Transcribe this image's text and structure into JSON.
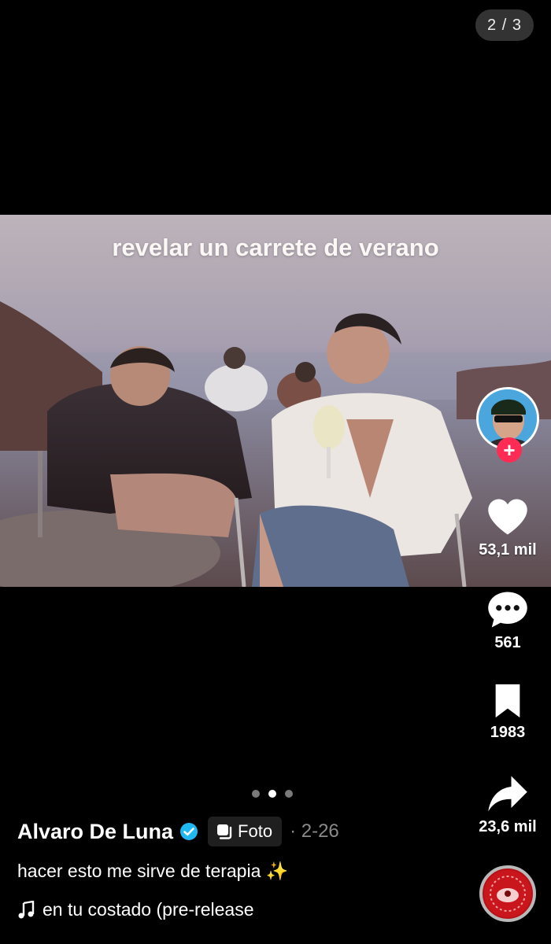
{
  "carousel": {
    "page_counter": "2 / 3",
    "total_pages": 3,
    "active_page": 2
  },
  "photo": {
    "overlay_text": "revelar un carrete de verano"
  },
  "actions": {
    "likes": "53,1 mil",
    "comments": "561",
    "saves": "1983",
    "shares": "23,6 mil"
  },
  "post": {
    "username": "Alvaro De Luna",
    "verified": true,
    "type_label": "Foto",
    "date": "· 2-26",
    "caption": "hacer esto me sirve de terapia",
    "caption_emoji": "✨",
    "music": "en tu costado (pre-release"
  },
  "icons": {
    "like": "heart-icon",
    "comment": "comment-bubble-icon",
    "save": "bookmark-icon",
    "share": "share-arrow-icon",
    "verified": "verified-badge-icon",
    "photo_type": "photo-stack-icon",
    "music": "music-note-icon"
  },
  "colors": {
    "background": "#000000",
    "follow_button": "#fe2c55",
    "verified": "#20b8f0",
    "date_text": "#8a8a8a",
    "chip_background": "#1f1f1f"
  }
}
